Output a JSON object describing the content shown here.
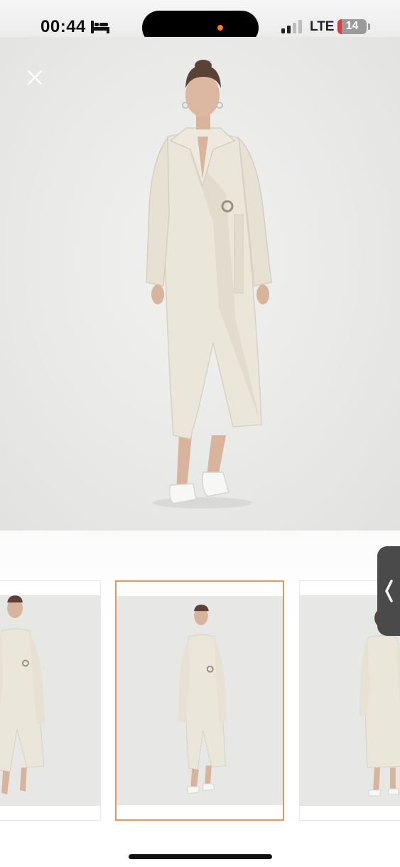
{
  "status_bar": {
    "time": "00:44",
    "focus_icon": "bed-icon",
    "signal_icon": "cellular-signal-icon",
    "network": "LTE",
    "battery_level": "14",
    "battery_fill_fraction": 0.14,
    "battery_color": "#e63b3b",
    "recording_dot_color": "#ff7a1a"
  },
  "gallery": {
    "close_icon": "close-icon",
    "main_image": "product-photo-front-view",
    "selected_index": 1,
    "accent_color": "#e8955a",
    "thumbnails": [
      {
        "view": "front-view-cropped"
      },
      {
        "view": "front-view"
      },
      {
        "view": "back-view"
      }
    ],
    "side_tab_icon": "chevron-left-icon"
  }
}
